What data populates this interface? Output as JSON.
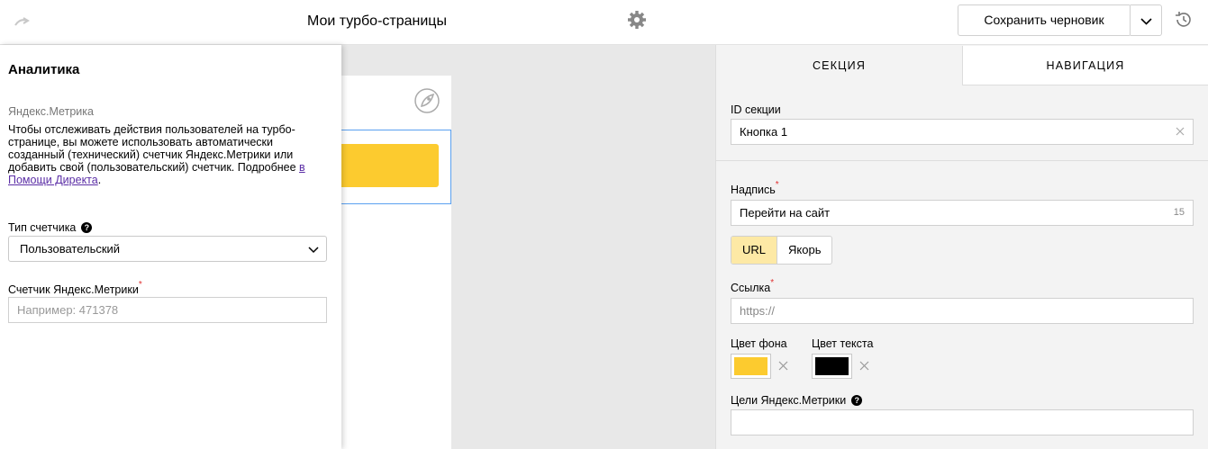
{
  "header": {
    "page_title": "Мои турбо-страницы",
    "save_draft_label": "Сохранить черновик"
  },
  "analytics_panel": {
    "title": "Аналитика",
    "subtitle": "Яндекс.Метрика",
    "description": "Чтобы отслеживать действия пользователей на турбо-странице, вы можете использовать автоматически созданный (технический) счетчик Яндекс.Метрики или добавить свой (пользовательский) счетчик. Подробнее ",
    "help_link": "в Помощи Директа",
    "desc_end": ".",
    "counter_type_label": "Тип счетчика",
    "counter_type_value": "Пользовательский",
    "counter_label": "Счетчик Яндекс.Метрики",
    "counter_placeholder": "Например: 471378"
  },
  "settings_panel": {
    "tabs": [
      "СЕКЦИЯ",
      "НАВИГАЦИЯ"
    ],
    "section_id_label": "ID секции",
    "section_id_value": "Кнопка 1",
    "caption_label": "Надпись",
    "caption_value": "Перейти на сайт",
    "caption_counter": "15",
    "link_types": [
      "URL",
      "Якорь"
    ],
    "link_label": "Ссылка",
    "link_placeholder": "https://",
    "bg_color_label": "Цвет фона",
    "bg_color": "#fccb2f",
    "text_color_label": "Цвет текста",
    "text_color": "#000000",
    "goals_label": "Цели Яндекс.Метрики"
  },
  "colors": {
    "accent": "#fccb2f",
    "link": "#5b2ea6",
    "required": "#e03131",
    "selection": "#5aa0f0"
  }
}
